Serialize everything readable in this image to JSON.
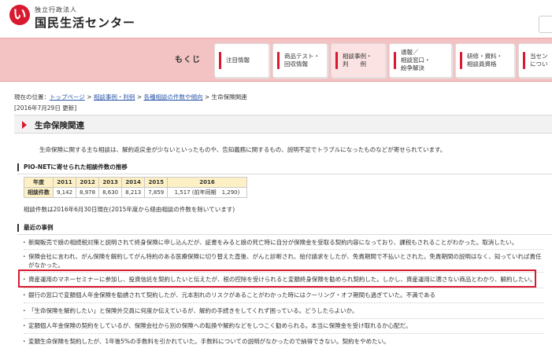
{
  "header": {
    "logo_mark": "い",
    "logo_sub": "独立行政法人",
    "logo_main": "国民生活センター"
  },
  "nav": {
    "mokuji": "もくじ",
    "tabs": [
      {
        "label": "注目情報"
      },
      {
        "label": "商品テスト・\n回収情報"
      },
      {
        "label": "相談事例・\n判　　例"
      },
      {
        "label": "通報／\n相談窓口・\n紛争解決"
      },
      {
        "label": "研修・資料・\n相談員資格"
      },
      {
        "label": "当セン\nについ"
      }
    ]
  },
  "breadcrumb": {
    "prefix": "現在の位置：",
    "items": [
      "トップページ",
      "相談事例・判例",
      "各種相談の件数や傾向"
    ],
    "sep": ">",
    "current": "生命保険関連"
  },
  "updated": "[2016年7月29日 更新]",
  "page_title": "生命保険関連",
  "intro": "生命保険に関する主な相談は、解約返戻金が少ないといったものや、告知義務に関するもの、説明不足でトラブルになったものなどが寄せられています。",
  "stats": {
    "heading": "PIO-NETに寄せられた相談件数の推移",
    "col_header": "年度",
    "row_header": "相談件数",
    "years": [
      "2011",
      "2012",
      "2013",
      "2014",
      "2015",
      "2016"
    ],
    "counts": [
      "9,142",
      "8,978",
      "8,630",
      "8,213",
      "7,859",
      "1,517 (前年同期　1,290)"
    ],
    "note": "相談件数は2016年6月30日現在(2015年度から経由相談の件数を除いています)"
  },
  "cases": {
    "heading": "最近の事例",
    "items": [
      "新聞販売で娘の相続税対策と説明されて終身保険に申し込んだが、証書をみると娘の死亡時に自分が保険金を受取る契約内容になっており、課税もされることがわかった。取消したい。",
      "保険会社に言われ、がん保険を解約してがん特約のある医療保険に切り替えた直後、がんと診断され、給付請求をしたが、免責期間で不払いとされた。免責期間の説明はなく、知っていれば責任がなかった。",
      "資産運用のマネーセミナーに参加し、投資信託を契約したいと伝えたが、税の控除を受けられると変額終身保険を勧められ契約した。しかし、資産運用に適さない商品とわかり、解約したい。",
      "銀行の窓口で変額個人年金保険を勧誘されて契約したが、元本割れのリスクがあることがわかった時にはクーリング・オフ期間も過ぎていた。不満である",
      "「生命保険を解約したい」と保険外交員に何度か伝えているが、解約の手続きをしてくれず困っている。どうしたらよいか。",
      "定額個人年金保険の契約をしているが、保険会社から別の保険への転換や解約などをしつこく勧められる。本当に保険金を受け取れるか心配だ。",
      "変額生命保険を契約したが、1年後5%の手数料を引かれていた。手数料についての説明がなかったので納得できない。契約をやめたい。"
    ]
  }
}
